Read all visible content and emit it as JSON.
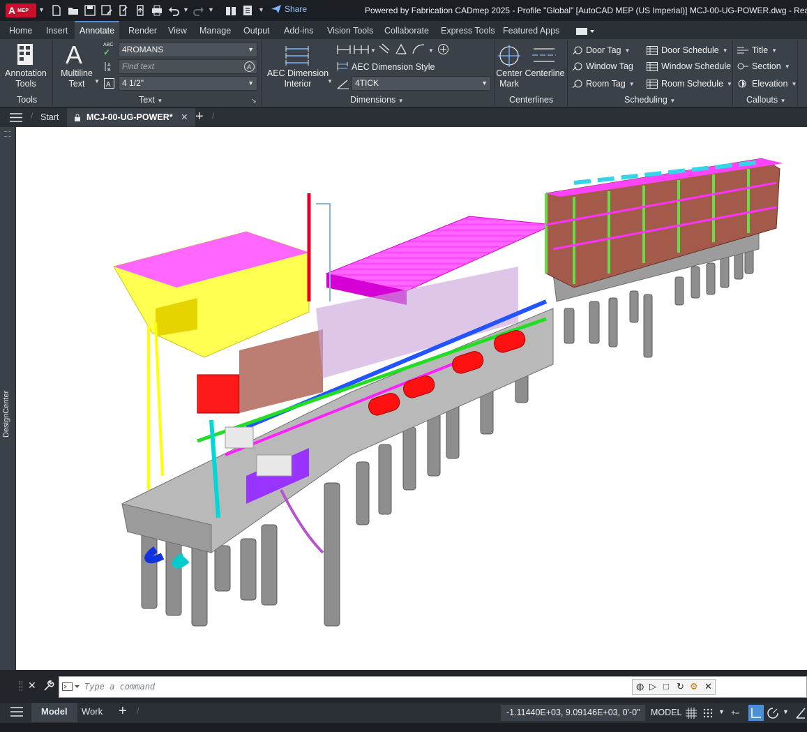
{
  "titlebar": {
    "app_letter": "A",
    "app_sub": "MEP",
    "share_label": "Share",
    "title": "Powered by Fabrication CADmep 2025 - Profile \"Global\"  [AutoCAD MEP (US Imperial)]     MCJ-00-UG-POWER.dwg - Rea"
  },
  "ribbon_tabs": [
    "Home",
    "Insert",
    "Annotate",
    "Render",
    "View",
    "Manage",
    "Output",
    "Add-ins",
    "Vision Tools",
    "Collaborate",
    "Express Tools",
    "Featured Apps"
  ],
  "ribbon_active_tab": "Annotate",
  "ribbon": {
    "tools": {
      "button_line1": "Annotation",
      "button_line2": "Tools",
      "panel": "Tools"
    },
    "text": {
      "multiline_line1": "Multiline",
      "multiline_line2": "Text",
      "style_value": "4ROMANS",
      "find_placeholder": "Find text",
      "height_value": "4 1/2\"",
      "spell_icon_text": "ABC",
      "panel": "Text"
    },
    "dimensions": {
      "aec_line1": "AEC Dimension",
      "aec_line2": "Interior",
      "aec_style_label": "AEC Dimension Style",
      "dim_style_value": "4TICK",
      "panel": "Dimensions"
    },
    "centerlines": {
      "center_line1": "Center",
      "center_line2": "Mark",
      "centerline_label": "Centerline",
      "panel": "Centerlines"
    },
    "scheduling": {
      "door_tag": "Door Tag",
      "window_tag": "Window Tag",
      "room_tag": "Room Tag",
      "door_schedule": "Door Schedule",
      "window_schedule": "Window Schedule",
      "room_schedule": "Room Schedule",
      "panel": "Scheduling"
    },
    "callouts": {
      "title": "Title",
      "section": "Section",
      "elevation": "Elevation",
      "panel": "Callouts"
    }
  },
  "file_tabs": {
    "start": "Start",
    "active": "MCJ-00-UG-POWER*"
  },
  "left_palette": {
    "label": "DesignCenter"
  },
  "command": {
    "placeholder": "Type  a  command"
  },
  "statusbar": {
    "model_tab": "Model",
    "work_tab": "Work",
    "coordinates": "-1.11440E+03, 9.09146E+03, 0'-0\"",
    "space": "MODEL"
  },
  "colors": {
    "accent": "#4a90d9",
    "ribbon_bg": "#3b4148",
    "titlebar_bg": "#1b1f24",
    "viewport_bg": "#ffffff",
    "magenta": "#ff00ff",
    "pier_gray": "#8c8c8c"
  }
}
